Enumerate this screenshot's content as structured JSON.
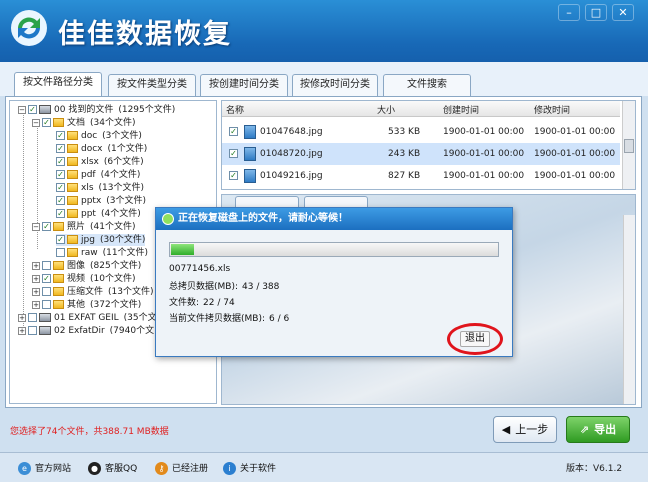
{
  "window": {
    "title": "佳佳数据恢复",
    "controls": {
      "minimize": "–",
      "maximize": "□",
      "close": "✕"
    }
  },
  "tabs": [
    {
      "label": "按文件路径分类",
      "active": true
    },
    {
      "label": "按文件类型分类",
      "active": false
    },
    {
      "label": "按创建时间分类",
      "active": false
    },
    {
      "label": "按修改时间分类",
      "active": false
    },
    {
      "label": "文件搜索",
      "active": false
    }
  ],
  "tree": {
    "nodes": [
      {
        "label": "00  找到的文件",
        "count": "(1295个文件)"
      },
      {
        "label": "文档",
        "count": "(34个文件)"
      },
      {
        "label": "doc",
        "count": "(3个文件)"
      },
      {
        "label": "docx",
        "count": "(1个文件)"
      },
      {
        "label": "xlsx",
        "count": "(6个文件)"
      },
      {
        "label": "pdf",
        "count": "(4个文件)"
      },
      {
        "label": "xls",
        "count": "(13个文件)"
      },
      {
        "label": "pptx",
        "count": "(3个文件)"
      },
      {
        "label": "ppt",
        "count": "(4个文件)"
      },
      {
        "label": "照片",
        "count": "(41个文件)"
      },
      {
        "label": "jpg",
        "count": "(30个文件)"
      },
      {
        "label": "raw",
        "count": "(11个文件)"
      },
      {
        "label": "图像",
        "count": "(825个文件)"
      },
      {
        "label": "视频",
        "count": "(10个文件)"
      },
      {
        "label": "压缩文件",
        "count": "(13个文件)"
      },
      {
        "label": "其他",
        "count": "(372个文件)"
      },
      {
        "label": "01  EXFAT GEIL",
        "count": "(35个文"
      },
      {
        "label": "02  ExfatDir",
        "count": "(7940个文"
      }
    ]
  },
  "filelist": {
    "columns": [
      "名称",
      "大小",
      "创建时间",
      "修改时间"
    ],
    "rows": [
      {
        "name": "01047648.jpg",
        "size": "533 KB",
        "created": "1900-01-01 00:00",
        "modified": "1900-01-01 00:00"
      },
      {
        "name": "01048720.jpg",
        "size": "243 KB",
        "created": "1900-01-01 00:00",
        "modified": "1900-01-01 00:00"
      },
      {
        "name": "01049216.jpg",
        "size": "827 KB",
        "created": "1900-01-01 00:00",
        "modified": "1900-01-01 00:00"
      }
    ]
  },
  "dialog": {
    "title": "正在恢复磁盘上的文件，请耐心等候！",
    "progress": 0.07,
    "current_file": "00771456.xls",
    "total_label": "总拷贝数据(MB):",
    "total_value": "43 / 388",
    "count_label": "文件数:",
    "count_value": "22 / 74",
    "current_label": "当前文件拷贝数据(MB):",
    "current_value": "6 / 6",
    "exit_label": "退出"
  },
  "status": {
    "selection": "您选择了74个文件，共388.71 MB数据"
  },
  "buttons": {
    "prev": "上一步",
    "export": "导出"
  },
  "footer": {
    "links": [
      "官方网站",
      "客服QQ",
      "已经注册",
      "关于软件"
    ],
    "version_label": "版本：",
    "version": "V6.1.2"
  },
  "colors": {
    "titlebar": "#1869b7",
    "selection_text": "#e02020",
    "export_button": "#2f9b22",
    "exit_circle": "#e0141c"
  }
}
